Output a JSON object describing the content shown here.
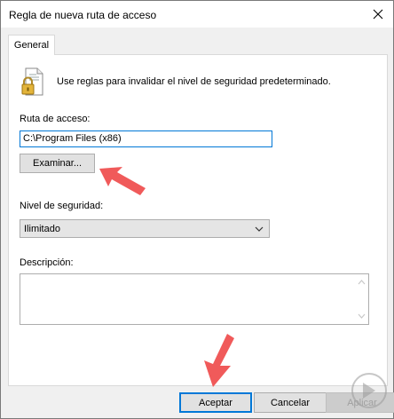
{
  "window": {
    "title": "Regla de nueva ruta de acceso"
  },
  "tabs": [
    {
      "label": "General"
    }
  ],
  "general": {
    "description": "Use reglas para invalidar el nivel de seguridad predeterminado.",
    "path_label": "Ruta de acceso:",
    "path_value": "C:\\Program Files (x86)",
    "browse_label": "Examinar...",
    "security_label": "Nivel de seguridad:",
    "security_value": "Ilimitado",
    "description_label": "Descripción:",
    "description_value": ""
  },
  "buttons": {
    "ok": "Aceptar",
    "cancel": "Cancelar",
    "apply": "Aplicar"
  },
  "icons": [
    "lock-file-icon",
    "close-icon",
    "chevron-down-icon",
    "scroll-up-icon",
    "scroll-down-icon",
    "arrow-pointer-icon"
  ],
  "colors": {
    "accent": "#0078d7",
    "arrow": "#f05a5a",
    "button_face": "#e1e1e1"
  }
}
